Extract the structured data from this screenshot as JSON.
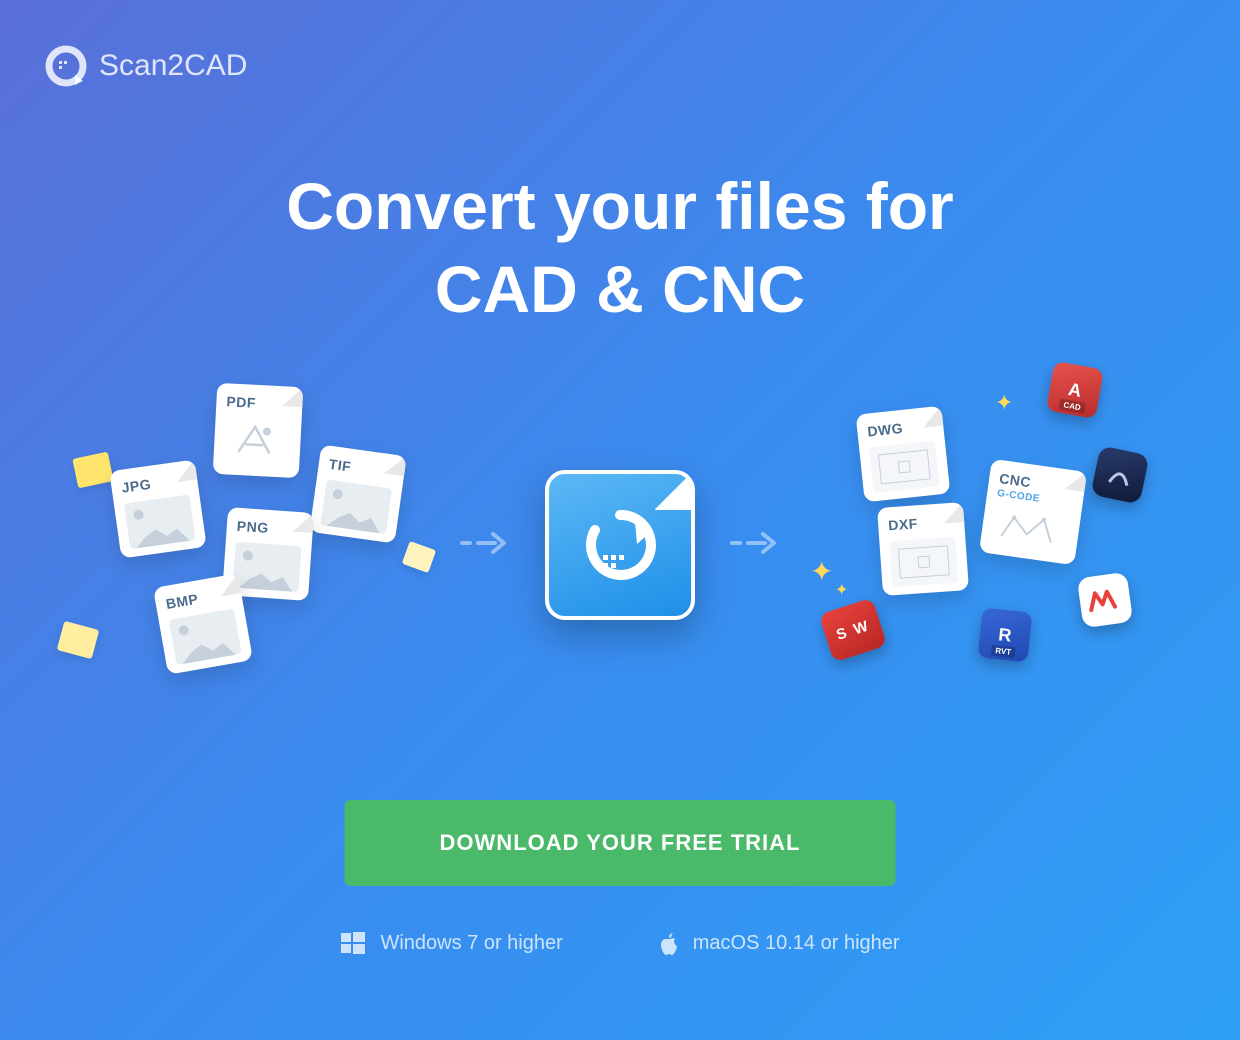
{
  "brand": "Scan2CAD",
  "headline_line1": "Convert your files for",
  "headline_line2": "CAD & CNC",
  "input_formats": {
    "pdf": "PDF",
    "tif": "TIF",
    "jpg": "JPG",
    "png": "PNG",
    "bmp": "BMP"
  },
  "output_formats": {
    "dwg": "DWG",
    "dxf": "DXF",
    "cnc": "CNC",
    "cnc_sub": "G-CODE"
  },
  "output_apps": {
    "autocad": "A",
    "autocad_sub": "CAD",
    "solidworks": "S W",
    "revit": "R",
    "revit_sub": "RVT"
  },
  "cta_label": "DOWNLOAD YOUR FREE TRIAL",
  "platforms": {
    "windows": "Windows 7 or higher",
    "mac": "macOS 10.14 or higher"
  }
}
